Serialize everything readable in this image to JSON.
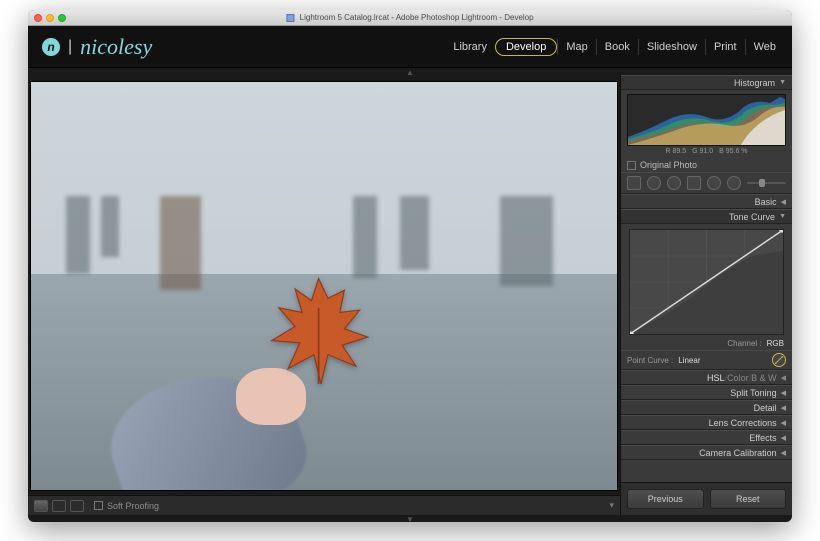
{
  "titlebar": "Lightroom 5 Catalog.lrcat - Adobe Photoshop Lightroom - Develop",
  "brand": {
    "logo": "n",
    "name": "nicolesy"
  },
  "modules": {
    "items": [
      "Library",
      "Develop",
      "Map",
      "Book",
      "Slideshow",
      "Print",
      "Web"
    ],
    "active": "Develop"
  },
  "imgfoot": {
    "soft_proofing": "Soft Proofing"
  },
  "side": {
    "histogram": {
      "label": "Histogram",
      "r": "R 89.5",
      "g": "G 91.0",
      "b": "B 95.6 %"
    },
    "original_photo": "Original Photo",
    "basic": "Basic",
    "tone_curve": {
      "label": "Tone Curve",
      "channel_label": "Channel :",
      "channel_value": "RGB",
      "point_curve_label": "Point Curve :",
      "point_curve_value": "Linear"
    },
    "hsl": {
      "hsl": "HSL",
      "color": "Color",
      "bw": "B & W"
    },
    "split_toning": "Split Toning",
    "detail": "Detail",
    "lens_corrections": "Lens Corrections",
    "effects": "Effects",
    "camera_calibration": "Camera Calibration",
    "previous": "Previous",
    "reset": "Reset"
  }
}
